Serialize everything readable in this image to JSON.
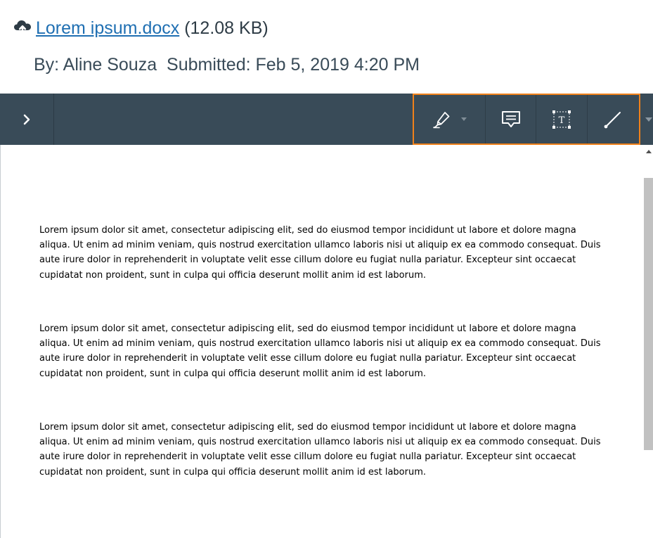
{
  "file": {
    "name": "Lorem ipsum.docx",
    "size": "(12.08 KB)"
  },
  "submission": {
    "author": "By: Aline Souza",
    "submitted": "Submitted: Feb 5, 2019 4:20 PM"
  },
  "toolbar": {
    "icons": [
      "chevron-right-icon",
      "highlighter-icon",
      "comment-icon",
      "text-box-icon",
      "line-icon",
      "chevron-down-icon"
    ]
  },
  "document": {
    "paragraphs": [
      "Lorem ipsum dolor sit amet, consectetur adipiscing elit, sed do eiusmod tempor incididunt ut labore et dolore magna aliqua. Ut enim ad minim veniam, quis nostrud exercitation ullamco laboris nisi ut aliquip ex ea commodo consequat. Duis aute irure dolor in reprehenderit in voluptate velit esse cillum dolore eu fugiat nulla pariatur. Excepteur sint occaecat cupidatat non proident, sunt in culpa qui officia deserunt mollit anim id est laborum.",
      "Lorem ipsum dolor sit amet, consectetur adipiscing elit, sed do eiusmod tempor incididunt ut labore et dolore magna aliqua. Ut enim ad minim veniam, quis nostrud exercitation ullamco laboris nisi ut aliquip ex ea commodo consequat. Duis aute irure dolor in reprehenderit in voluptate velit esse cillum dolore eu fugiat nulla pariatur. Excepteur sint occaecat cupidatat non proident, sunt in culpa qui officia deserunt mollit anim id est laborum.",
      "Lorem ipsum dolor sit amet, consectetur adipiscing elit, sed do eiusmod tempor incididunt ut labore et dolore magna aliqua. Ut enim ad minim veniam, quis nostrud exercitation ullamco laboris nisi ut aliquip ex ea commodo consequat. Duis aute irure dolor in reprehenderit in voluptate velit esse cillum dolore eu fugiat nulla pariatur. Excepteur sint occaecat cupidatat non proident, sunt in culpa qui officia deserunt mollit anim id est laborum."
    ]
  },
  "colors": {
    "toolbar_bg": "#394b58",
    "highlight_border": "#f0811a",
    "link": "#1f6fb2"
  }
}
